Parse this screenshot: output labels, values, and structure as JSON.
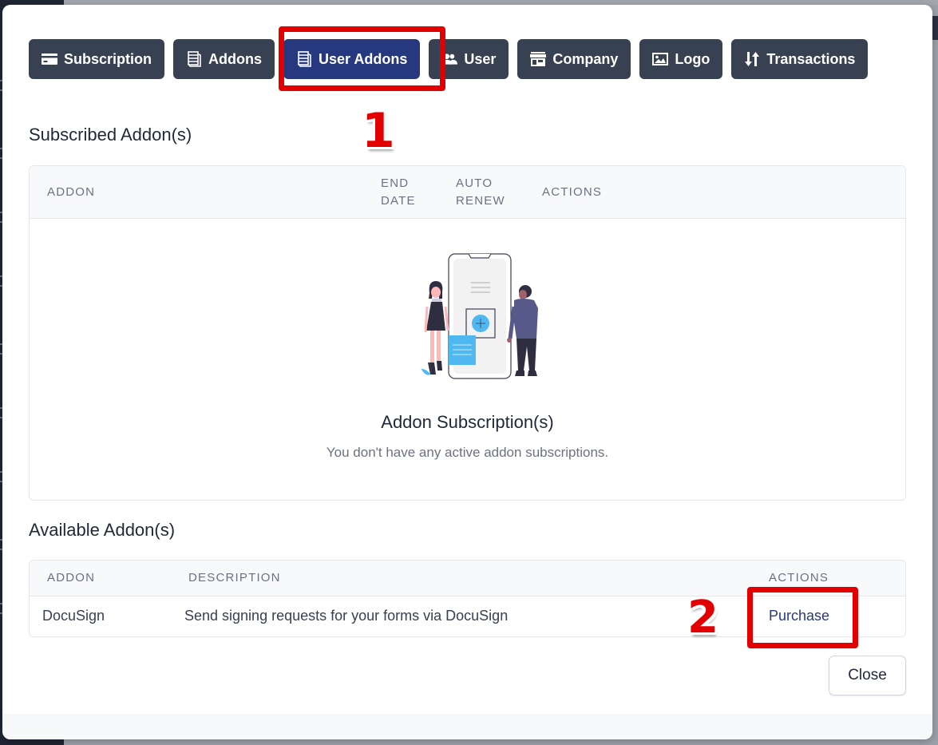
{
  "tabs": [
    {
      "label": "Subscription",
      "icon": "credit-card-icon",
      "active": false
    },
    {
      "label": "Addons",
      "icon": "stack-icon",
      "active": false
    },
    {
      "label": "User Addons",
      "icon": "stack-icon",
      "active": true
    },
    {
      "label": "User",
      "icon": "users-icon",
      "active": false
    },
    {
      "label": "Company",
      "icon": "store-icon",
      "active": false
    },
    {
      "label": "Logo",
      "icon": "image-icon",
      "active": false
    },
    {
      "label": "Transactions",
      "icon": "sort-arrows-icon",
      "active": false
    }
  ],
  "annotations": {
    "step1": "1",
    "step2": "2",
    "highlight_color": "#e30000"
  },
  "subscribed": {
    "title": "Subscribed Addon(s)",
    "columns": [
      "ADDON",
      "END DATE",
      "AUTO RENEW",
      "ACTIONS"
    ],
    "columns_split": {
      "addon": "ADDON",
      "end_date_1": "END",
      "end_date_2": "DATE",
      "auto_renew_1": "AUTO",
      "auto_renew_2": "RENEW",
      "actions": "ACTIONS"
    },
    "empty_title": "Addon Subscription(s)",
    "empty_message": "You don't have any active addon subscriptions."
  },
  "available": {
    "title": "Available Addon(s)",
    "columns": [
      "ADDON",
      "DESCRIPTION",
      "ACTIONS"
    ],
    "rows": [
      {
        "addon": "DocuSign",
        "description": "Send signing requests for your forms via DocuSign",
        "action": "Purchase"
      }
    ]
  },
  "footer": {
    "close_label": "Close"
  },
  "colors": {
    "tab_bg": "#374151",
    "tab_active_bg": "#26397f",
    "link": "#26397f",
    "illustration_accent": "#4fb8f0",
    "illustration_shirt": "#575a89"
  }
}
